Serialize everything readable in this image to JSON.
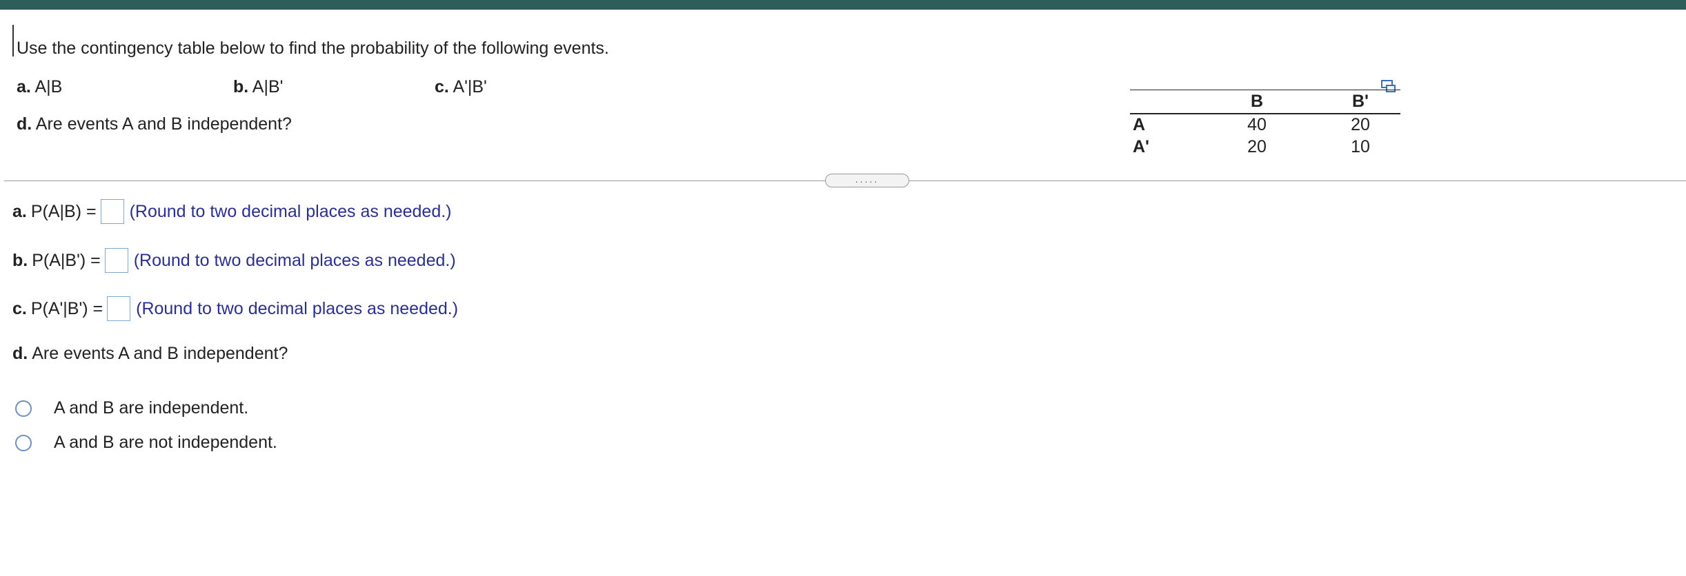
{
  "question": {
    "prompt": "Use the contingency table below to find the probability of the following events.",
    "parts": [
      {
        "letter": "a.",
        "text": "A|B"
      },
      {
        "letter": "b.",
        "text": "A|B'"
      },
      {
        "letter": "c.",
        "text": "A'|B'"
      },
      {
        "letter": "d.",
        "text": "Are events A and B independent?"
      }
    ]
  },
  "table": {
    "col_headers": [
      "B",
      "B'"
    ],
    "rows": [
      {
        "label": "A",
        "values": [
          "40",
          "20"
        ]
      },
      {
        "label": "A'",
        "values": [
          "20",
          "10"
        ]
      }
    ]
  },
  "copy_icon": "copy-table-icon",
  "divider_handle": ".....",
  "answers": [
    {
      "letter": "a.",
      "expr": "P(A|B) =",
      "hint": "(Round to two decimal places as needed.)",
      "value": ""
    },
    {
      "letter": "b.",
      "expr": "P(A|B') =",
      "hint": "(Round to two decimal places as needed.)",
      "value": ""
    },
    {
      "letter": "c.",
      "expr": "P(A'|B') =",
      "hint": "(Round to two decimal places as needed.)",
      "value": ""
    }
  ],
  "part_d": {
    "letter": "d.",
    "question": "Are events A and B independent?",
    "options": [
      "A and B are independent.",
      "A and B are not independent."
    ]
  },
  "colors": {
    "topbar": "#2d5f5a",
    "hint": "#2b2f8f",
    "radio": "#6f8fb8"
  }
}
